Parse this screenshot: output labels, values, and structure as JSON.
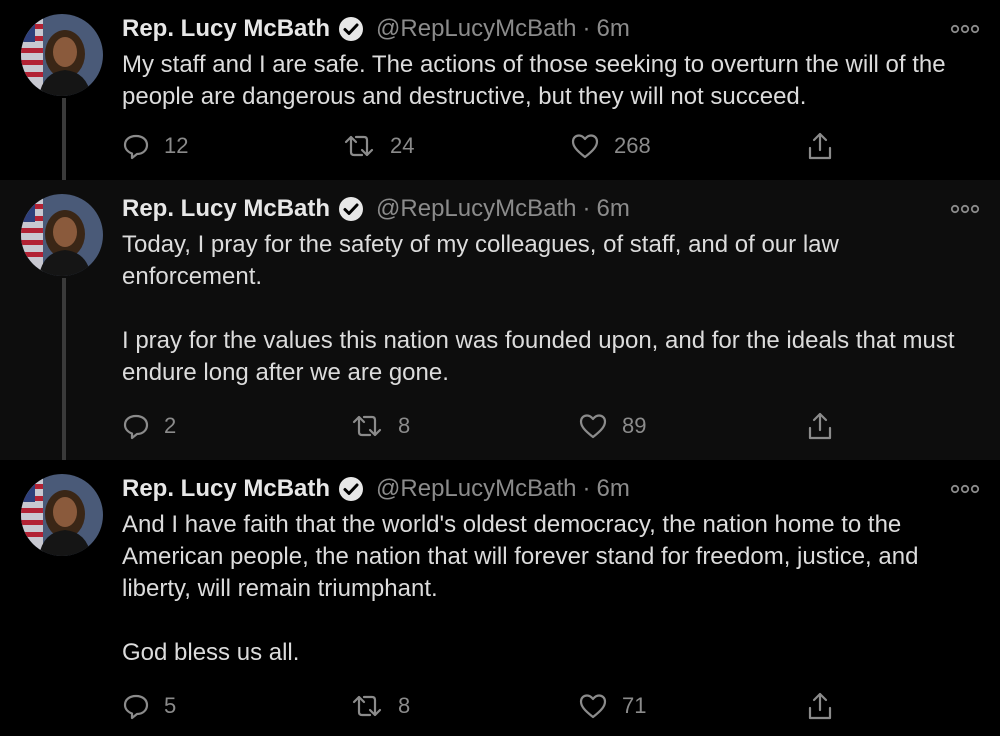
{
  "colors": {
    "background": "#000000",
    "alt_background": "#0d0d0d",
    "text": "#dcdcdc",
    "muted": "#8b8b8b",
    "thread_line": "#3a3a3a"
  },
  "tweets": [
    {
      "author": {
        "name": "Rep. Lucy McBath",
        "handle": "@RepLucyMcBath",
        "verified": true
      },
      "separator": "·",
      "time": "6m",
      "paragraphs": [
        "My staff and I are safe. The actions of those seeking to overturn the will of the people are dangerous and destructive, but they will not succeed."
      ],
      "replies": "12",
      "retweets": "24",
      "likes": "268",
      "icons": {
        "reply": "reply-icon",
        "retweet": "retweet-icon",
        "like": "heart-icon",
        "share": "share-icon",
        "more": "more-icon"
      }
    },
    {
      "author": {
        "name": "Rep. Lucy McBath",
        "handle": "@RepLucyMcBath",
        "verified": true
      },
      "separator": "·",
      "time": "6m",
      "paragraphs": [
        "Today, I pray for the safety of my colleagues, of staff, and of our law enforcement.",
        "I pray for the values this nation was founded upon, and for the ideals that must endure long after we are gone."
      ],
      "replies": "2",
      "retweets": "8",
      "likes": "89",
      "icons": {
        "reply": "reply-icon",
        "retweet": "retweet-icon",
        "like": "heart-icon",
        "share": "share-icon",
        "more": "more-icon"
      }
    },
    {
      "author": {
        "name": "Rep. Lucy McBath",
        "handle": "@RepLucyMcBath",
        "verified": true
      },
      "separator": "·",
      "time": "6m",
      "paragraphs": [
        "And I have faith that the world's oldest democracy, the nation home to the American people, the nation that will forever stand for freedom, justice, and liberty, will remain triumphant.",
        "God bless us all."
      ],
      "replies": "5",
      "retweets": "8",
      "likes": "71",
      "icons": {
        "reply": "reply-icon",
        "retweet": "retweet-icon",
        "like": "heart-icon",
        "share": "share-icon",
        "more": "more-icon"
      }
    }
  ]
}
